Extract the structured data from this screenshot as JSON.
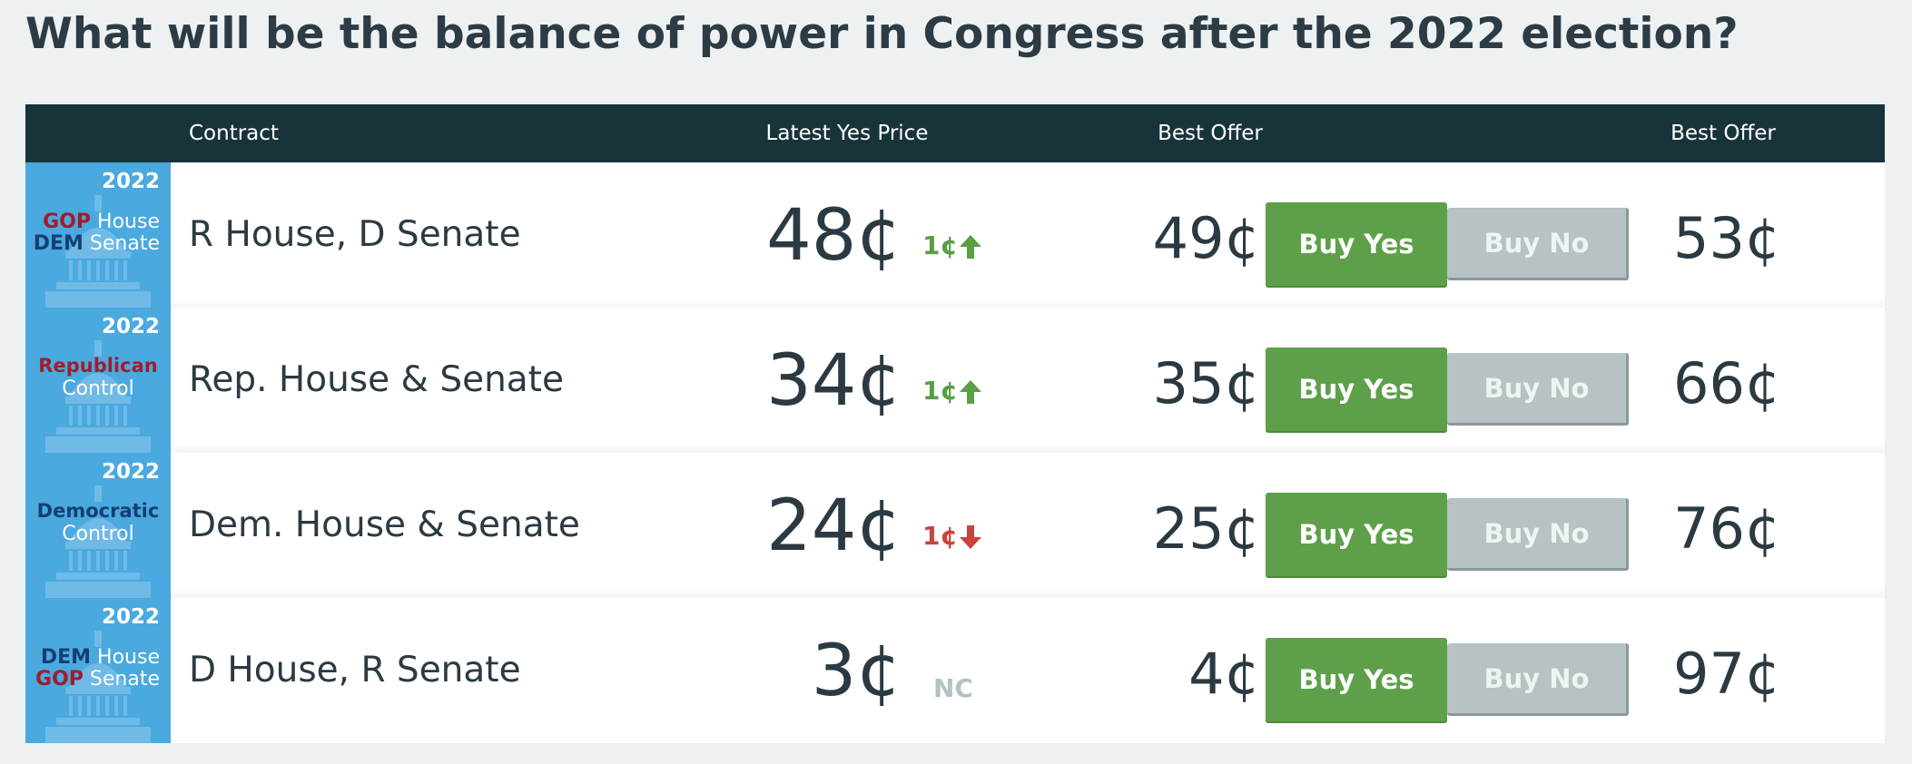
{
  "page": {
    "title": "What will be the balance of power in Congress after the 2022 election?"
  },
  "table": {
    "headers": {
      "contract": "Contract",
      "latest_yes_price": "Latest Yes Price",
      "best_offer_yes": "Best Offer",
      "best_offer_no": "Best Offer"
    },
    "rows": [
      {
        "thumb": {
          "year": "2022",
          "line1_party": "GOP",
          "line1_chamber": "House",
          "line2_party": "DEM",
          "line2_chamber": "Senate"
        },
        "contract": "R House, D Senate",
        "latest_price": "48¢",
        "change": "1¢",
        "change_direction": "up",
        "best_offer_yes": "49¢",
        "buy_yes_label": "Buy Yes",
        "buy_no_label": "Buy No",
        "best_offer_no": "53¢"
      },
      {
        "thumb": {
          "year": "2022",
          "party": "Republican",
          "word": "Control"
        },
        "contract": "Rep. House & Senate",
        "latest_price": "34¢",
        "change": "1¢",
        "change_direction": "up",
        "best_offer_yes": "35¢",
        "buy_yes_label": "Buy Yes",
        "buy_no_label": "Buy No",
        "best_offer_no": "66¢"
      },
      {
        "thumb": {
          "year": "2022",
          "party": "Democratic",
          "word": "Control"
        },
        "contract": "Dem. House & Senate",
        "latest_price": "24¢",
        "change": "1¢",
        "change_direction": "down",
        "best_offer_yes": "25¢",
        "buy_yes_label": "Buy Yes",
        "buy_no_label": "Buy No",
        "best_offer_no": "76¢"
      },
      {
        "thumb": {
          "year": "2022",
          "line1_party": "DEM",
          "line1_chamber": "House",
          "line2_party": "GOP",
          "line2_chamber": "Senate"
        },
        "contract": "D House, R Senate",
        "latest_price": "3¢",
        "change": "NC",
        "change_direction": "none",
        "best_offer_yes": "4¢",
        "buy_yes_label": "Buy Yes",
        "buy_no_label": "Buy No",
        "best_offer_no": "97¢"
      }
    ]
  },
  "colors": {
    "header_bg": "#18343b",
    "thumb_bg": "#4aa9df",
    "buy_yes": "#5da049",
    "buy_no": "#b6c2c3",
    "up": "#5a9e44",
    "down": "#c9443c",
    "republican": "#a11d2b",
    "democrat": "#153f73"
  },
  "icons": {
    "up": "arrow-up-icon",
    "down": "arrow-down-icon",
    "thumb": "capitol-icon"
  }
}
